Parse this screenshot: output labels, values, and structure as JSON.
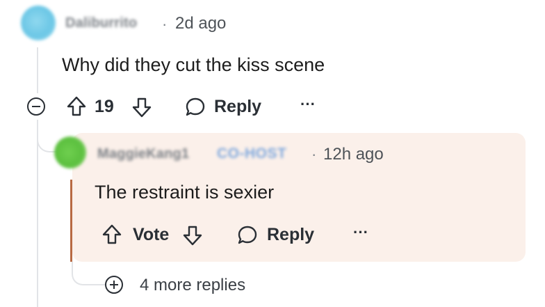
{
  "comment": {
    "username": "Daliburrito",
    "separator": "·",
    "time": "2d ago",
    "body": "Why did they cut the kiss scene",
    "votes": "19",
    "reply_label": "Reply",
    "more_label": "···"
  },
  "reply": {
    "username": "MaggieKang1",
    "badge": "CO-HOST",
    "separator": "·",
    "time": "12h ago",
    "body": "The restraint is sexier",
    "vote_label": "Vote",
    "reply_label": "Reply",
    "more_label": "···"
  },
  "thread": {
    "more_replies": "4 more replies"
  },
  "colors": {
    "reply_background": "#fbf0ea",
    "reply_accent": "#b86a43",
    "cohost_badge": "#7da7dd"
  },
  "icons": [
    "collapse-icon",
    "upvote-icon",
    "downvote-icon",
    "comment-bubble-icon",
    "more-icon",
    "expand-icon"
  ]
}
